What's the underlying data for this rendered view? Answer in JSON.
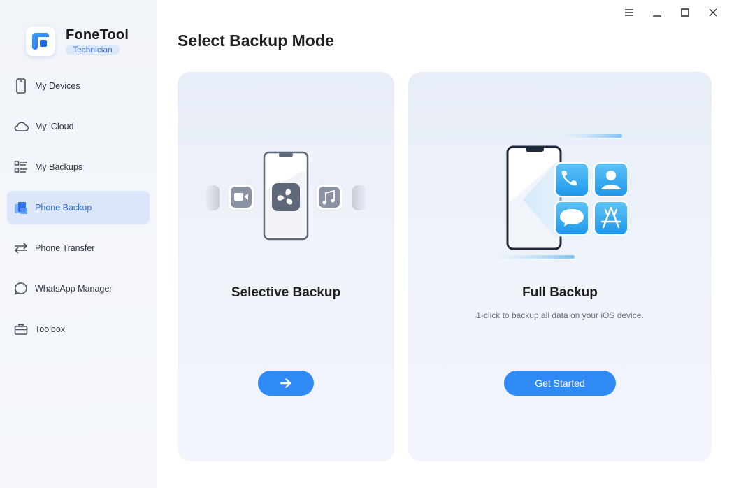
{
  "app": {
    "name": "FoneTool",
    "edition": "Technician"
  },
  "sidebar": {
    "items": [
      {
        "label": "My Devices",
        "icon": "phone-icon",
        "active": false
      },
      {
        "label": "My iCloud",
        "icon": "cloud-icon",
        "active": false
      },
      {
        "label": "My Backups",
        "icon": "list-icon",
        "active": false
      },
      {
        "label": "Phone Backup",
        "icon": "backup-icon",
        "active": true
      },
      {
        "label": "Phone Transfer",
        "icon": "transfer-arrows-icon",
        "active": false
      },
      {
        "label": "WhatsApp Manager",
        "icon": "chat-bubble-icon",
        "active": false
      },
      {
        "label": "Toolbox",
        "icon": "toolbox-icon",
        "active": false
      }
    ]
  },
  "window_controls": [
    "menu-icon",
    "minimize-icon",
    "maximize-icon",
    "close-icon"
  ],
  "main": {
    "title": "Select Backup Mode",
    "cards": {
      "selective": {
        "title": "Selective Backup",
        "button_icon": "arrow-right-icon"
      },
      "full": {
        "title": "Full Backup",
        "description": "1-click to backup all data on your iOS device.",
        "button_label": "Get Started"
      }
    }
  },
  "colors": {
    "accent": "#2f8af5",
    "active_nav_bg": "#dbe6fb",
    "active_nav_text": "#2c6fe6",
    "card_bg": "#ebf0f9"
  }
}
